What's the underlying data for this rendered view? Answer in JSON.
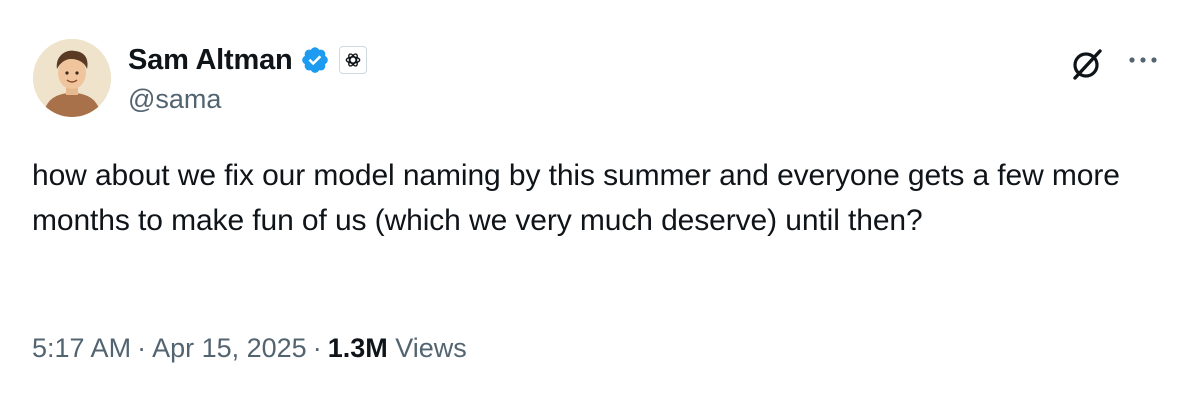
{
  "author": {
    "display_name": "Sam Altman",
    "handle": "@sama",
    "avatar_icon": "avatar-illustration",
    "verified_icon": "verified-badge-icon",
    "affiliate_icon": "openai-logo-icon"
  },
  "actions": {
    "grok_icon": "grok-icon",
    "more_icon": "more-options-icon"
  },
  "tweet": {
    "text": "how about we fix our model naming by this summer and everyone gets a few more months to make fun of us (which we very much deserve) until then?"
  },
  "meta": {
    "time": "5:17 AM",
    "separator": "·",
    "date": "Apr 15, 2025",
    "views_count": "1.3M",
    "views_label": "Views"
  },
  "colors": {
    "primary_text": "#0f1419",
    "secondary_text": "#536471",
    "verified_blue": "#1d9bf0"
  }
}
